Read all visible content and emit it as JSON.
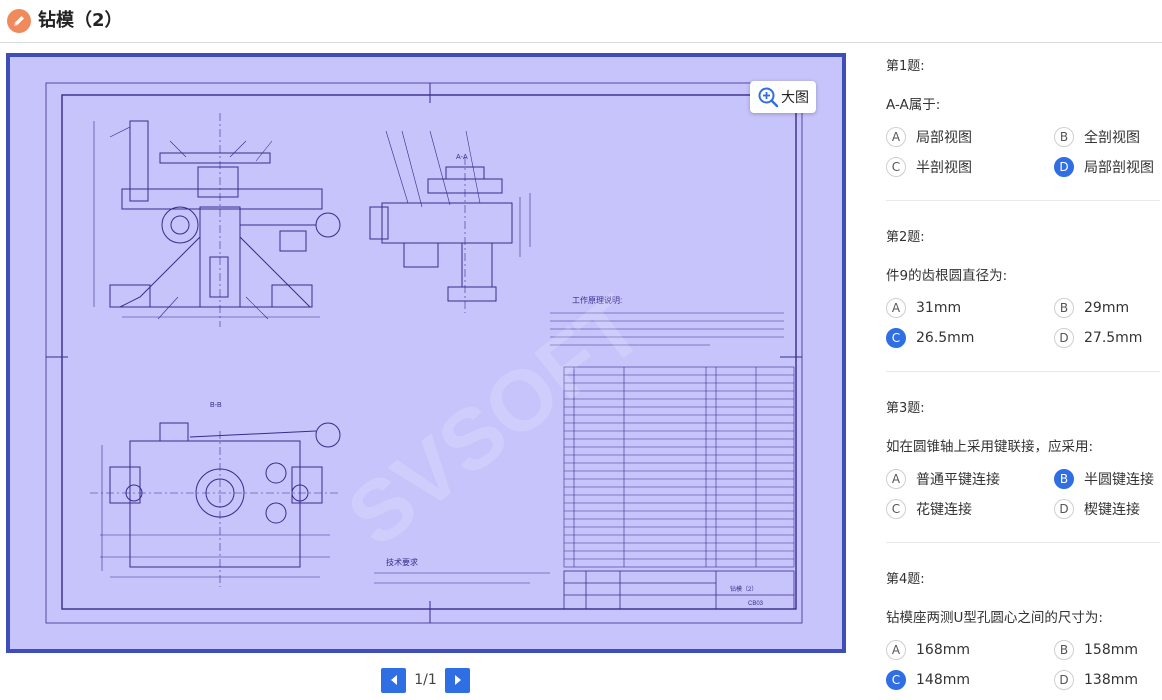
{
  "header": {
    "title": "钻模（2）"
  },
  "viewer": {
    "zoom_label": "大图",
    "drawing": {
      "section_aa": "A-A",
      "section_bb": "B-B",
      "work_title": "工作原理说明:",
      "tech_title": "技术要求",
      "watermark": "SVSOFT",
      "title_block_name": "钻模（2）",
      "title_block_code": "CB03"
    }
  },
  "pager": {
    "label": "1/1"
  },
  "questions": [
    {
      "no": "第1题:",
      "text": "A-A属于:",
      "options": [
        {
          "letter": "A",
          "text": "局部视图",
          "selected": false
        },
        {
          "letter": "B",
          "text": "全剖视图",
          "selected": false
        },
        {
          "letter": "C",
          "text": "半剖视图",
          "selected": false
        },
        {
          "letter": "D",
          "text": "局部剖视图",
          "selected": true
        }
      ]
    },
    {
      "no": "第2题:",
      "text": "件9的齿根圆直径为:",
      "options": [
        {
          "letter": "A",
          "text": "31mm",
          "selected": false
        },
        {
          "letter": "B",
          "text": "29mm",
          "selected": false
        },
        {
          "letter": "C",
          "text": "26.5mm",
          "selected": true
        },
        {
          "letter": "D",
          "text": "27.5mm",
          "selected": false
        }
      ]
    },
    {
      "no": "第3题:",
      "text": "如在圆锥轴上采用键联接，应采用:",
      "options": [
        {
          "letter": "A",
          "text": "普通平键连接",
          "selected": false
        },
        {
          "letter": "B",
          "text": "半圆键连接",
          "selected": true
        },
        {
          "letter": "C",
          "text": "花键连接",
          "selected": false
        },
        {
          "letter": "D",
          "text": "楔键连接",
          "selected": false
        }
      ]
    },
    {
      "no": "第4题:",
      "text": "钻模座两测U型孔圆心之间的尺寸为:",
      "options": [
        {
          "letter": "A",
          "text": "168mm",
          "selected": false
        },
        {
          "letter": "B",
          "text": "158mm",
          "selected": false
        },
        {
          "letter": "C",
          "text": "148mm",
          "selected": true
        },
        {
          "letter": "D",
          "text": "138mm",
          "selected": false
        }
      ]
    }
  ],
  "colors": {
    "accent": "#2f6fe3",
    "viewer_border": "#3f4db8",
    "viewer_bg": "#c6c4fb",
    "drawing_line": "#3a2b8c"
  }
}
